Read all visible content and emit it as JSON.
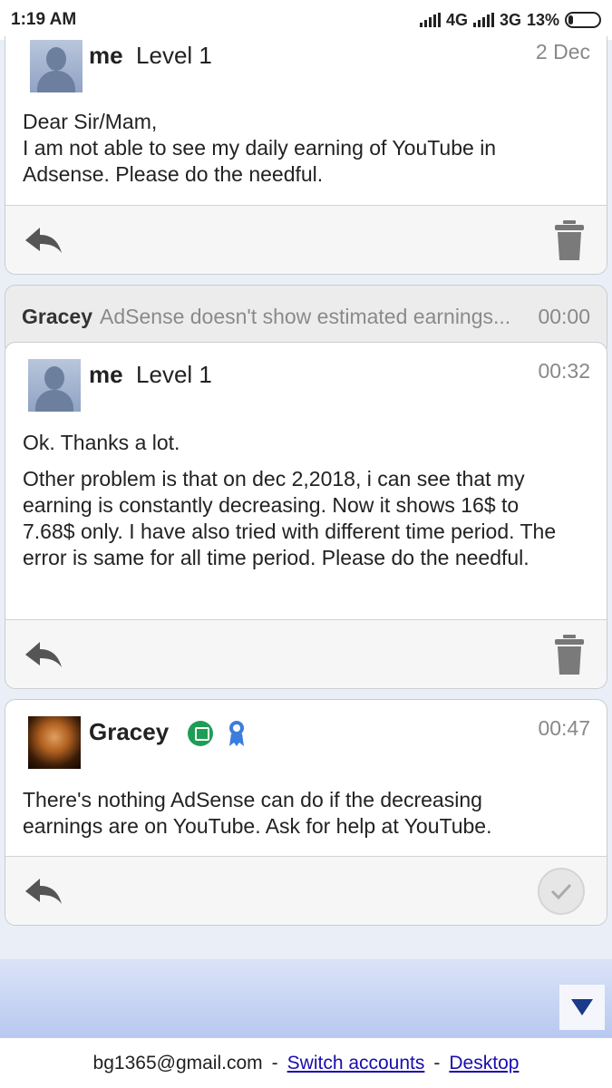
{
  "status_bar": {
    "time": "1:19 AM",
    "network1": "4G",
    "network2": "3G",
    "battery": "13%"
  },
  "messages": [
    {
      "author": "me",
      "level": "Level 1",
      "time": "2 Dec",
      "text_lines": [
        "Dear Sir/Mam,",
        "I am not able to see my daily earning of YouTube in",
        "Adsense. Please do the needful."
      ]
    },
    {
      "author": "me",
      "level": "Level 1",
      "time": "00:32",
      "text_lines": [
        "Ok. Thanks a lot.",
        "",
        "Other problem is that on dec 2,2018, i can see that my",
        "earning is constantly decreasing. Now it shows 16$ to",
        "7.68$ only. I have also tried with different time period. The",
        "error is same for all time period. Please do the needful."
      ]
    },
    {
      "author": "Gracey",
      "time": "00:47",
      "text_lines": [
        "There's nothing AdSense can do if the decreasing",
        "earnings are on YouTube. Ask for help at YouTube."
      ]
    }
  ],
  "collapsed": {
    "name": "Gracey",
    "subject": "AdSense doesn't show estimated earnings...",
    "time": "00:00"
  },
  "footer": {
    "email": "bg1365@gmail.com",
    "sep1": "-",
    "switch": "Switch accounts",
    "sep2": "-",
    "desktop": "Desktop"
  }
}
